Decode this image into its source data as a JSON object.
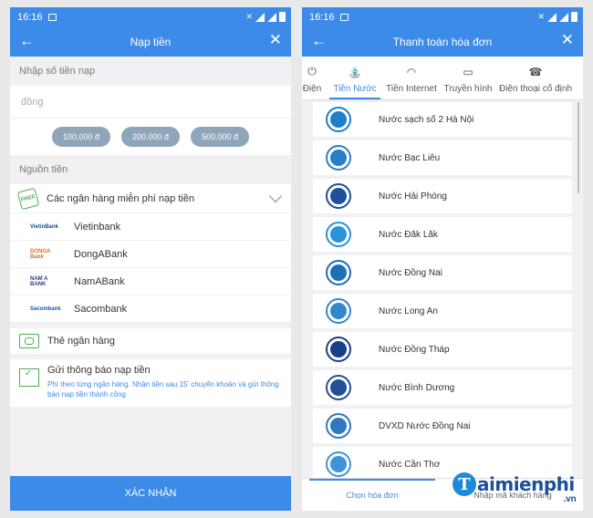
{
  "left": {
    "status_time": "16:16",
    "title": "Nạp tiền",
    "amount_label": "Nhập số tiền nạp",
    "amount_placeholder": "đồng",
    "presets": [
      "100.000 đ",
      "200.000 đ",
      "500.000 đ"
    ],
    "source_label": "Nguồn tiền",
    "free_badge": "FREE",
    "free_banks_label": "Các ngân hàng miễn phí nạp tiền",
    "banks": [
      {
        "logo": "VietinBank",
        "name": "Vietinbank"
      },
      {
        "logo": "DONGA Bank",
        "name": "DongABank"
      },
      {
        "logo": "NAM A BANK",
        "name": "NamABank"
      },
      {
        "logo": "Sacombank",
        "name": "Sacombank"
      }
    ],
    "card_label": "Thẻ ngân hàng",
    "notify_title": "Gửi thông báo nạp tiền",
    "notify_desc": "Phí theo từng ngân hàng. Nhận tiền sau 15' chuyển khoản và gửi thông báo nạp tiền thành công",
    "confirm_label": "XÁC NHẬN"
  },
  "right": {
    "status_time": "16:16",
    "title": "Thanh toán hóa đơn",
    "tabs": [
      {
        "label": "Điện",
        "icon": "power-icon"
      },
      {
        "label": "Tiền Nước",
        "icon": "faucet-icon"
      },
      {
        "label": "Tiền Internet",
        "icon": "wifi-icon"
      },
      {
        "label": "Truyền hình",
        "icon": "tv-icon"
      },
      {
        "label": "Điện thoại cố định",
        "icon": "telephone-icon"
      }
    ],
    "providers": [
      {
        "name": "Nước sạch số 2 Hà Nội",
        "color": "#1f7fc9"
      },
      {
        "name": "Nước Bạc Liêu",
        "color": "#2a7ec8"
      },
      {
        "name": "Nước Hải Phòng",
        "color": "#1f4f9a"
      },
      {
        "name": "Nước Đăk Lăk",
        "color": "#2a92d8"
      },
      {
        "name": "Nước Đồng Nai",
        "color": "#1d6fb8"
      },
      {
        "name": "Nước Long An",
        "color": "#3387c9"
      },
      {
        "name": "Nước Đồng Tháp",
        "color": "#1a3f8a"
      },
      {
        "name": "Nước Bình Dương",
        "color": "#254e96"
      },
      {
        "name": "DVXD Nước Đồng Nai",
        "color": "#2f77c0"
      },
      {
        "name": "Nước Cần Thơ",
        "color": "#3e95d6"
      }
    ],
    "bottom_tabs": [
      "Chọn hóa đơn",
      "Nhập mã khách hàng"
    ]
  },
  "watermark": {
    "letter": "T",
    "text": "aimienphi",
    "suffix": ".vn"
  }
}
